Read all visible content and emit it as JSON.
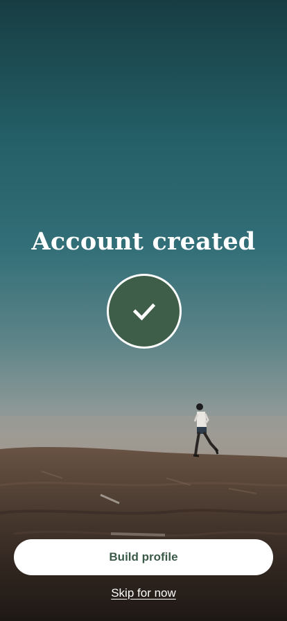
{
  "screen": {
    "title": "Account created",
    "status_icon": "checkmark-icon",
    "background_image": "runner-on-desert-hill-photo"
  },
  "actions": {
    "primary_label": "Build profile",
    "secondary_label": "Skip for now"
  },
  "colors": {
    "accent_green": "#3f5e4a",
    "button_text": "#3b5b48",
    "button_background": "#ffffff",
    "text_on_photo": "#ffffff"
  }
}
